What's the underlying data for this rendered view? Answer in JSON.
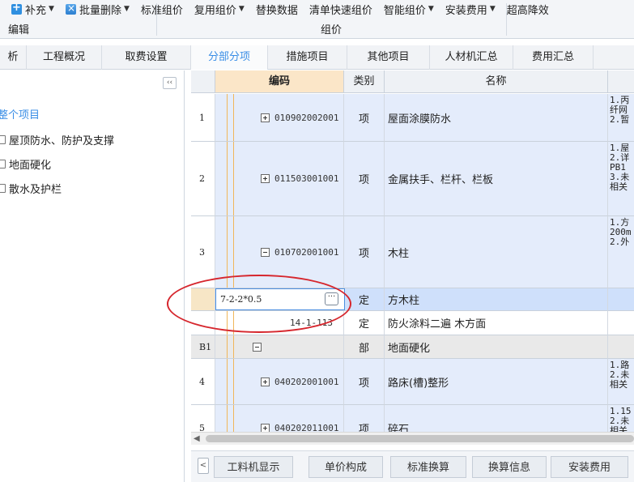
{
  "toolbar": {
    "items": [
      {
        "label": "补充",
        "has_caret": true,
        "icon": "add-icon"
      },
      {
        "label": "批量删除",
        "has_caret": true,
        "icon": "batch-delete-icon"
      },
      {
        "label": "标准组价",
        "has_caret": false
      },
      {
        "label": "复用组价",
        "has_caret": true
      },
      {
        "label": "替换数据",
        "has_caret": false
      },
      {
        "label": "清单快速组价",
        "has_caret": false
      },
      {
        "label": "智能组价",
        "has_caret": true
      },
      {
        "label": "安装费用",
        "has_caret": true
      },
      {
        "label": "超高降效",
        "has_caret": false
      }
    ],
    "groups": {
      "edit": "编辑",
      "pricing": "组价"
    }
  },
  "tabs": [
    {
      "label": "析",
      "active": false
    },
    {
      "label": "工程概况",
      "active": false
    },
    {
      "label": "取费设置",
      "active": false
    },
    {
      "label": "分部分项",
      "active": true
    },
    {
      "label": "措施项目",
      "active": false
    },
    {
      "label": "其他项目",
      "active": false
    },
    {
      "label": "人材机汇总",
      "active": false
    },
    {
      "label": "费用汇总",
      "active": false
    }
  ],
  "tree": {
    "collapse_glyph": "‹‹",
    "root": "整个项目",
    "nodes": [
      "屋顶防水、防护及支撑",
      "地面硬化",
      "散水及护栏"
    ]
  },
  "grid": {
    "columns": {
      "code": "编码",
      "type": "类别",
      "name": "名称"
    },
    "rows": [
      {
        "num": "1",
        "code": "010902002001",
        "type": "项",
        "name": "屋面涂膜防水",
        "desc": [
          "1.丙",
          "纤网",
          "2.暂"
        ],
        "expander": "plus",
        "style": "blue"
      },
      {
        "num": "2",
        "code": "011503001001",
        "type": "项",
        "name": "金属扶手、栏杆、栏板",
        "desc": [
          "1.屋",
          "2.详",
          "PB1",
          "3.未",
          "相关"
        ],
        "expander": "plus",
        "style": "blue"
      },
      {
        "num": "3",
        "code": "010702001001",
        "type": "项",
        "name": "木柱",
        "desc": [
          "1.方",
          "200m",
          "2.外"
        ],
        "expander": "minus",
        "style": "blue"
      },
      {
        "num": "",
        "code": "7-2-2*0.5",
        "type": "定",
        "name": "方木柱",
        "desc": [],
        "expander": "",
        "style": "selected"
      },
      {
        "num": "",
        "code": "14-1-113",
        "type": "定",
        "name": "防火涂料二遍 木方面",
        "desc": [],
        "expander": "",
        "style": "white"
      },
      {
        "num": "B1",
        "code": "",
        "type": "部",
        "name": "地面硬化",
        "desc": [],
        "expander": "minus",
        "style": "gray"
      },
      {
        "num": "4",
        "code": "040202001001",
        "type": "项",
        "name": "路床(槽)整形",
        "desc": [
          "1.路",
          "2.未",
          "相关"
        ],
        "expander": "plus",
        "style": "blue"
      },
      {
        "num": "5",
        "code": "040202011001",
        "type": "项",
        "name": "碎石",
        "desc": [
          "1.15",
          "2.未",
          "相关"
        ],
        "expander": "plus",
        "style": "blue"
      }
    ],
    "edit_value": "7-2-2*0.5",
    "edit_button": "···"
  },
  "bottom_tabs": {
    "nav": "<",
    "items": [
      "工料机显示",
      "单价构成",
      "标准换算",
      "换算信息",
      "安装费用"
    ]
  }
}
